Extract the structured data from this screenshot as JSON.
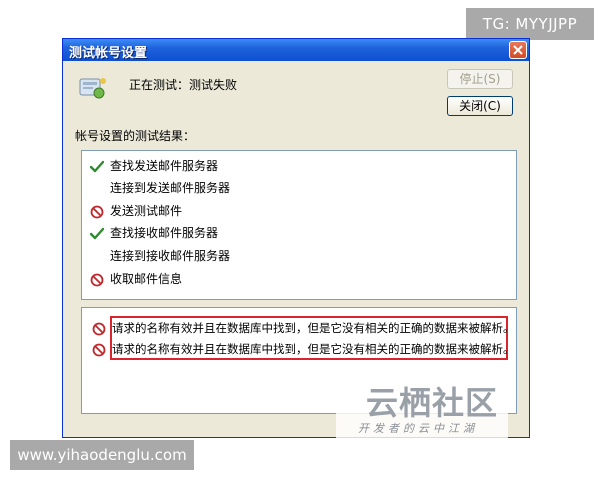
{
  "watermarks": {
    "tg": "TG: MYYJJPP",
    "site": "www.yihaodenglu.com",
    "logo_main": "云栖社区",
    "logo_sub": "开发者的云中江湖"
  },
  "window": {
    "title": "测试帐号设置",
    "close_icon": "close-x-icon"
  },
  "status": {
    "icon": "mail-test-icon",
    "text": "正在测试：测试失败"
  },
  "buttons": {
    "stop": "停止(S)",
    "close": "关闭(C)"
  },
  "results": {
    "heading": "帐号设置的测试结果：",
    "items": [
      {
        "status": "success",
        "icon": "check-icon",
        "label": "查找发送邮件服务器"
      },
      {
        "status": "none",
        "icon": "",
        "label": "连接到发送邮件服务器"
      },
      {
        "status": "error",
        "icon": "prohibited-icon",
        "label": "发送测试邮件"
      },
      {
        "status": "success",
        "icon": "check-icon",
        "label": "查找接收邮件服务器"
      },
      {
        "status": "none",
        "icon": "",
        "label": "连接到接收邮件服务器"
      },
      {
        "status": "error",
        "icon": "prohibited-icon",
        "label": "收取邮件信息"
      }
    ]
  },
  "errors": {
    "items": [
      {
        "icon": "prohibited-icon",
        "message": "请求的名称有效并且在数据库中找到，但是它没有相关的正确的数据来被解析。"
      },
      {
        "icon": "prohibited-icon",
        "message": "请求的名称有效并且在数据库中找到，但是它没有相关的正确的数据来被解析。"
      }
    ]
  },
  "colors": {
    "success": "#2e8b2e",
    "error": "#c0282c",
    "highlight": "#d9252b",
    "titlebar": "#1f63dc"
  }
}
